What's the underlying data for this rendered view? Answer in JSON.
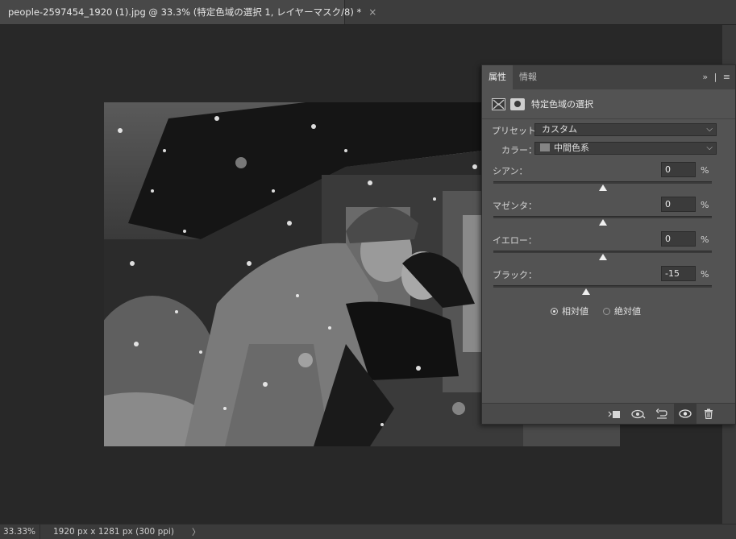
{
  "document_tab": {
    "title": "people-2597454_1920 (1).jpg @ 33.3% (特定色域の選択 1, レイヤーマスク/8) *",
    "close_glyph": "×"
  },
  "status": {
    "zoom": "33.33%",
    "dimensions": "1920 px x 1281 px (300 ppi)",
    "arrow": "〉"
  },
  "panel": {
    "tabs": [
      {
        "label": "属性",
        "active": true
      },
      {
        "label": "情報",
        "active": false
      }
    ],
    "menu_expand": "»",
    "menu_sep": "|",
    "menu_icon": "≡",
    "title": "特定色域の選択",
    "preset_label": "プリセット：",
    "preset_value": "カスタム",
    "color_label": "カラー：",
    "color_value": "中間色系",
    "color_swatch": "#858585",
    "sliders": [
      {
        "label": "シアン：",
        "value": "0",
        "unit": "%",
        "slider": 0
      },
      {
        "label": "マゼンタ：",
        "value": "0",
        "unit": "%",
        "slider": 0
      },
      {
        "label": "イエロー：",
        "value": "0",
        "unit": "%",
        "slider": 0
      },
      {
        "label": "ブラック：",
        "value": "-15",
        "unit": "%",
        "slider": -15
      }
    ],
    "method": {
      "relative": "相対値",
      "absolute": "絶対値",
      "selected": "relative"
    },
    "footer_icons": [
      "clip-to-layer-icon",
      "view-previous-state-icon",
      "reset-icon",
      "visibility-eye-icon",
      "trash-icon"
    ]
  }
}
